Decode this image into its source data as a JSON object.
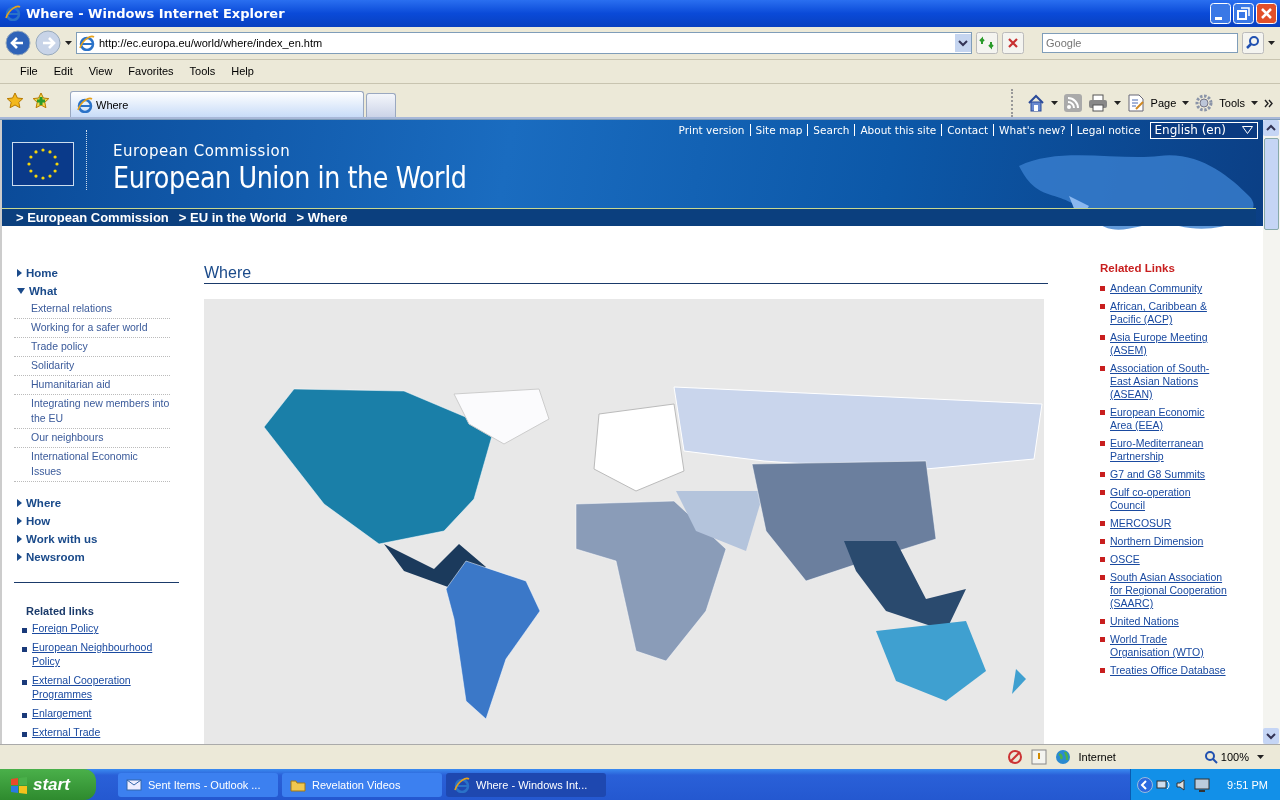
{
  "window": {
    "title": "Where - Windows Internet Explorer"
  },
  "address_bar": {
    "value": "http://ec.europa.eu/world/where/index_en.htm"
  },
  "search": {
    "placeholder": "Google"
  },
  "menu": [
    "File",
    "Edit",
    "View",
    "Favorites",
    "Tools",
    "Help"
  ],
  "tabs": [
    {
      "label": "Where",
      "selected": true
    }
  ],
  "command_bar": [
    "Page",
    "Tools"
  ],
  "page": {
    "top_links": [
      "Print version",
      "Site map",
      "Search",
      "About this site",
      "Contact",
      "What's new?",
      "Legal notice"
    ],
    "language": "English (en)",
    "header": {
      "subtitle": "European Commission",
      "title": "European Union in the World"
    },
    "breadcrumb": [
      "> European Commission",
      "> EU in the World",
      "> Where"
    ],
    "nav": [
      {
        "label": "Home",
        "expanded": false
      },
      {
        "label": "What",
        "expanded": true,
        "children": [
          "External relations",
          "Working for a safer world",
          "Trade policy",
          "Solidarity",
          "Humanitarian aid",
          "Integrating new members into the EU",
          "Our neighbours",
          "International Economic Issues"
        ]
      },
      {
        "label": "Where",
        "expanded": false
      },
      {
        "label": "How",
        "expanded": false
      },
      {
        "label": "Work with us",
        "expanded": false
      },
      {
        "label": "Newsroom",
        "expanded": false
      }
    ],
    "related_links_left": {
      "title": "Related links",
      "items": [
        "Foreign Policy",
        "European Neighbourhood Policy",
        "External Cooperation Programmes",
        "Enlargement",
        "External Trade"
      ]
    },
    "heading": "Where",
    "related_links_right": {
      "title": "Related Links",
      "items": [
        "Andean Community",
        "African, Caribbean & Pacific (ACP)",
        "Asia Europe Meeting (ASEM)",
        "Association of South-East Asian Nations (ASEAN)",
        "European Economic Area (EEA)",
        "Euro-Mediterranean Partnership",
        "G7 and G8 Summits",
        "Gulf co-operation Council",
        "MERCOSUR",
        "Northern Dimension",
        "OSCE",
        "South Asian Association for Regional Cooperation (SAARC)",
        "United Nations",
        "World Trade Organisation (WTO)",
        "Treaties Office Database"
      ]
    }
  },
  "status_bar": {
    "zone": "Internet",
    "zoom": "100%"
  },
  "taskbar": {
    "start": "start",
    "tasks": [
      {
        "label": "Sent Items - Outlook ...",
        "selected": false
      },
      {
        "label": "Revelation Videos",
        "selected": false
      },
      {
        "label": "Where - Windows Int...",
        "selected": true
      }
    ],
    "clock": "9:51 PM"
  }
}
